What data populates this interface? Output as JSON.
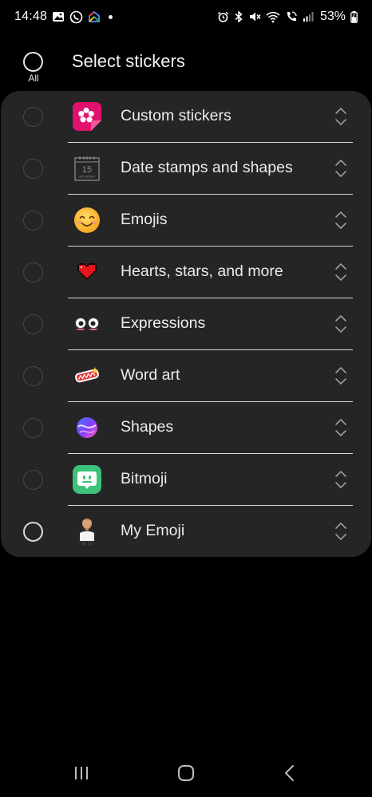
{
  "status_bar": {
    "time": "14:48",
    "left_icons": [
      "gallery-icon",
      "whatsapp-icon",
      "google-home-icon",
      "notification-dot-icon"
    ],
    "right_icons": [
      "alarm-icon",
      "bluetooth-icon",
      "mute-icon",
      "wifi-icon",
      "wifi-calling-icon",
      "signal-icon"
    ],
    "battery": "53%"
  },
  "header": {
    "all_label": "All",
    "title": "Select stickers"
  },
  "sticker_list": [
    {
      "label": "Custom stickers",
      "icon": "custom-stickers-icon"
    },
    {
      "label": "Date stamps and shapes",
      "icon": "calendar-date-icon",
      "date_number": "15",
      "date_day": "SATURDAY"
    },
    {
      "label": "Emojis",
      "icon": "smiley-emoji-icon"
    },
    {
      "label": "Hearts, stars, and more",
      "icon": "pixel-heart-icon"
    },
    {
      "label": "Expressions",
      "icon": "expressions-eyes-icon"
    },
    {
      "label": "Word art",
      "icon": "word-art-icon"
    },
    {
      "label": "Shapes",
      "icon": "shapes-orb-icon"
    },
    {
      "label": "Bitmoji",
      "icon": "bitmoji-icon"
    },
    {
      "label": "My Emoji",
      "icon": "my-emoji-avatar-icon"
    }
  ],
  "colors": {
    "background": "#000000",
    "card": "#252525",
    "custom_stickers_accent": "#e0126e",
    "bitmoji_accent": "#3cc27a"
  },
  "nav_bar": {
    "buttons": [
      "recents-icon",
      "home-icon",
      "back-icon"
    ]
  }
}
